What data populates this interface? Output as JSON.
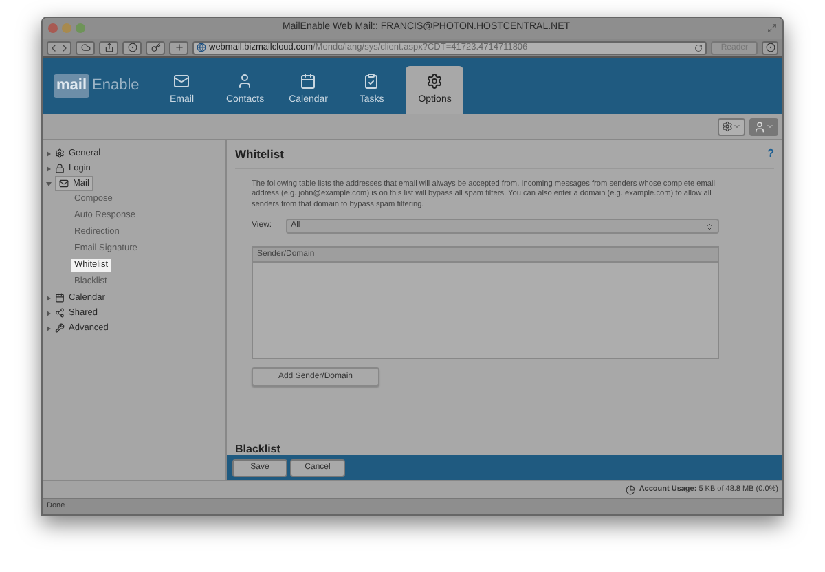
{
  "window": {
    "title": "MailEnable Web Mail:: FRANCIS@PHOTON.HOSTCENTRAL.NET"
  },
  "toolbar": {
    "url_host": "webmail.bizmailcloud.com",
    "url_path": "/Mondo/lang/sys/client.aspx?CDT=41723.4714711806",
    "reader": "Reader"
  },
  "logo": {
    "part_1": "mail",
    "part_2": "Enable"
  },
  "tabs": [
    {
      "label": "Email",
      "selected": false
    },
    {
      "label": "Contacts",
      "selected": false
    },
    {
      "label": "Calendar",
      "selected": false
    },
    {
      "label": "Tasks",
      "selected": false
    },
    {
      "label": "Options",
      "selected": true
    }
  ],
  "sidebar": {
    "items": [
      {
        "label": "General",
        "expanded": false
      },
      {
        "label": "Login",
        "expanded": false
      },
      {
        "label": "Mail",
        "expanded": true,
        "children": [
          {
            "label": "Compose",
            "selected": false
          },
          {
            "label": "Auto Response",
            "selected": false
          },
          {
            "label": "Redirection",
            "selected": false
          },
          {
            "label": "Email Signature",
            "selected": false
          },
          {
            "label": "Whitelist",
            "selected": true
          },
          {
            "label": "Blacklist",
            "selected": false
          }
        ]
      },
      {
        "label": "Calendar",
        "expanded": false
      },
      {
        "label": "Shared",
        "expanded": false
      },
      {
        "label": "Advanced",
        "expanded": false
      }
    ]
  },
  "panel": {
    "title": "Whitelist",
    "help": "?",
    "description": "The following table lists the addresses that email will always be accepted from. Incoming messages from senders whose complete email address (e.g. john@example.com) is on this list will bypass all spam filters. You can also enter a domain (e.g. example.com) to allow all senders from that domain to bypass spam filtering.",
    "view_label": "View:",
    "view_value": "All",
    "table": {
      "columns": [
        "Sender/Domain"
      ]
    },
    "add_button": "Add Sender/Domain",
    "next_heading": "Blacklist"
  },
  "footer": {
    "buttons": [
      "Save",
      "Cancel"
    ]
  },
  "usage": {
    "label": "Account Usage:",
    "value": "5 KB of 48.8 MB (0.0%)"
  },
  "status_bar": "Done"
}
